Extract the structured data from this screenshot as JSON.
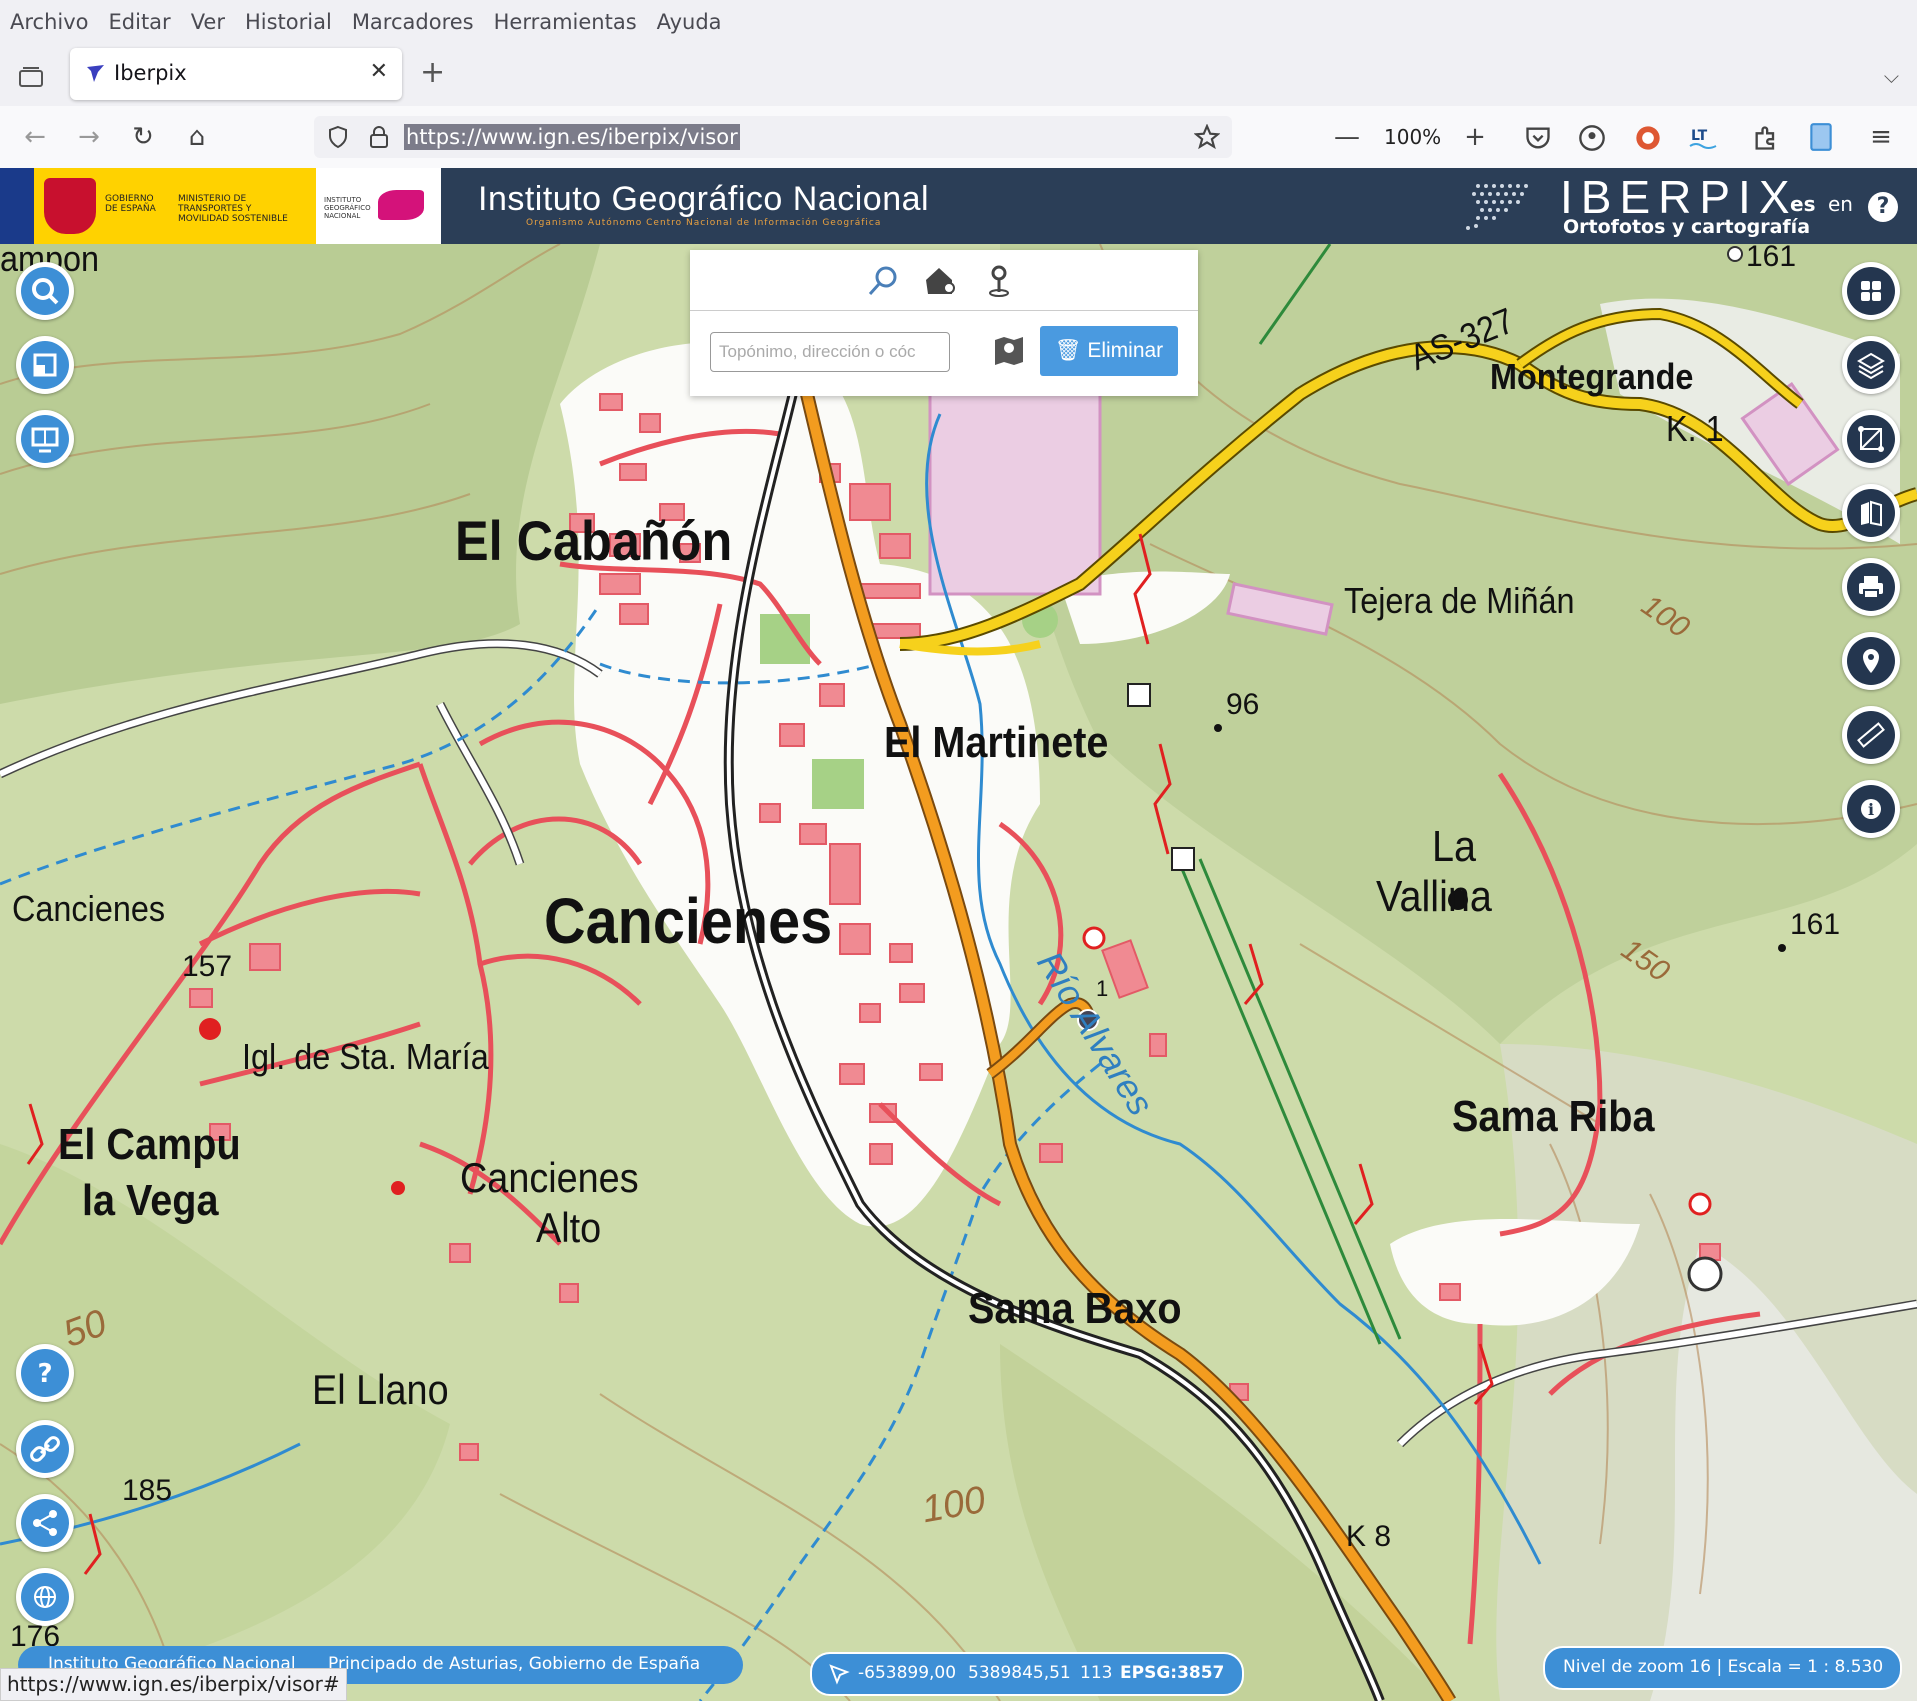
{
  "menu": [
    "Archivo",
    "Editar",
    "Ver",
    "Historial",
    "Marcadores",
    "Herramientas",
    "Ayuda"
  ],
  "tab": {
    "title": "Iberpix",
    "close": "✕",
    "new": "+",
    "overflow": "⌵"
  },
  "nav": {
    "back": "←",
    "forward": "→",
    "reload": "↻",
    "home": "⌂",
    "url": "https://www.ign.es/iberpix/visor",
    "zoom_out": "—",
    "zoom": "100%",
    "zoom_in": "+",
    "menu": "≡"
  },
  "header": {
    "gov1": "GOBIERNO DE ESPAÑA",
    "gov2": "MINISTERIO DE TRANSPORTES Y MOVILIDAD SOSTENIBLE",
    "cnig": "INSTITUTO GEOGRÁFICO NACIONAL",
    "ign_title": "Instituto Geográfico Nacional",
    "ign_sub": "Organismo Autónomo   Centro Nacional de Información Geográfica",
    "brand": "IBERPIX",
    "brand_sub": "Ortofotos y cartografía",
    "lang_es": "es",
    "lang_en": "en",
    "help": "?"
  },
  "search": {
    "placeholder": "Topónimo, dirección o cóc",
    "delete_label": "Eliminar",
    "delete_icon": "🗑"
  },
  "map_labels": {
    "campon": "ampon",
    "cabanon": "El Cabañón",
    "martinete": "El Martinete",
    "cancienes": "Cancienes",
    "cancienes_w": "Cancienes",
    "iglesia": "Igl. de Sta. María",
    "campu": "El Campu",
    "vega": "la Vega",
    "cancienes_alto1": "Cancienes",
    "cancienes_alto2": "Alto",
    "sama_baxo": "Sama Baxo",
    "llano": "El Llano",
    "tejera": "Tejera de Miñán",
    "montegrande": "Montegrande",
    "as327": "AS-327",
    "k1": "K. 1",
    "la": "La",
    "vallina": "Vallina",
    "sama_riba": "Sama Riba",
    "rio": "Río Alvares",
    "k8": "K 8",
    "e96": "96",
    "e157": "157",
    "e161a": "161",
    "e161b": "161",
    "e185": "185",
    "e176": "176",
    "c100a": "100",
    "c100b": "100",
    "c150": "150",
    "c50": "50",
    "marker": "1"
  },
  "footer": {
    "attrib1": "Instituto Geográfico Nacional",
    "attrib2": "Principado de Asturias, Gobierno de España",
    "coord_x": "-653899,00",
    "coord_y": "5389845,51",
    "coord_z": "113",
    "epsg": "EPSG:3857",
    "scale": "Nivel de zoom 16 | Escala = 1 : 8.530",
    "status_url": "https://www.ign.es/iberpix/visor#"
  },
  "colors": {
    "header": "#2b3e57",
    "accent": "#3d8fd6",
    "map_bg": "#cfdcae",
    "road_orange": "#f39c1f",
    "road_yellow": "#f6d11c",
    "urban": "#e8505a"
  }
}
